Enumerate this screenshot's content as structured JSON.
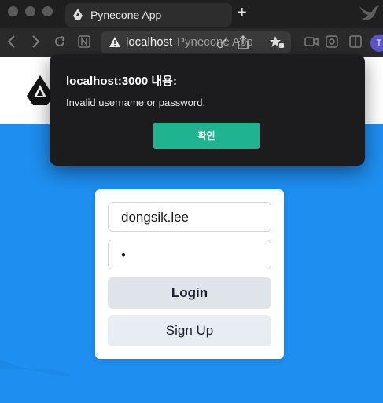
{
  "browser": {
    "tab_title": "Pynecone App",
    "new_tab_symbol": "+",
    "url_host": "localhost",
    "url_rest": "Pynecone App",
    "profile_initial": "T"
  },
  "login_form": {
    "username_value": "dongsik.lee",
    "password_value": "•",
    "login_label": "Login",
    "signup_label": "Sign Up"
  },
  "alert": {
    "title": "localhost:3000 내용:",
    "message": "Invalid username or password.",
    "ok_label": "확인"
  },
  "colors": {
    "page_background": "#1e8ef0",
    "alert_button": "#1fb38f"
  }
}
